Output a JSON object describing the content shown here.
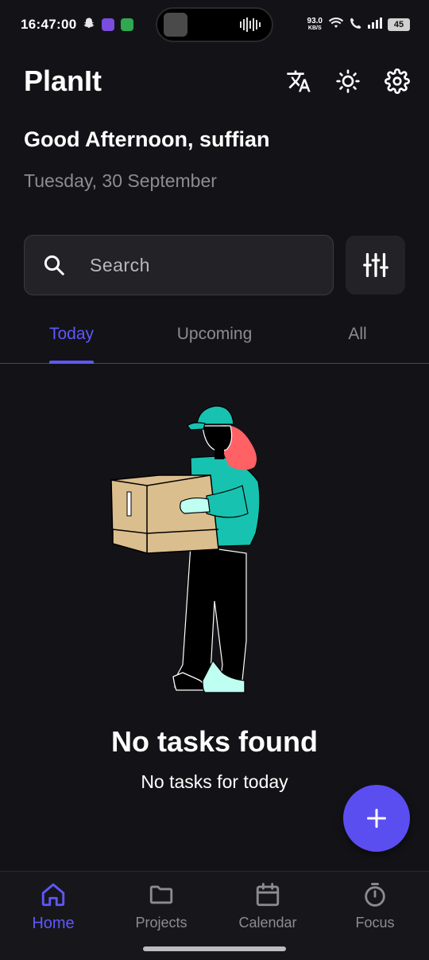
{
  "status_bar": {
    "time": "16:47:00",
    "net_speed_value": "93.0",
    "net_speed_unit": "KB/S",
    "battery": "45"
  },
  "header": {
    "title": "PlanIt",
    "icons": [
      "translate-icon",
      "brightness-icon",
      "settings-icon"
    ]
  },
  "greeting": "Good Afternoon, suffian",
  "date": "Tuesday, 30 September",
  "search": {
    "placeholder": "Search"
  },
  "tabs": [
    {
      "label": "Today",
      "active": true
    },
    {
      "label": "Upcoming",
      "active": false
    },
    {
      "label": "All",
      "active": false
    }
  ],
  "empty_state": {
    "title": "No tasks found",
    "subtitle": "No tasks for today"
  },
  "bottom_nav": [
    {
      "label": "Home",
      "icon": "home-icon",
      "active": true
    },
    {
      "label": "Projects",
      "icon": "folder-icon",
      "active": false
    },
    {
      "label": "Calendar",
      "icon": "calendar-icon",
      "active": false
    },
    {
      "label": "Focus",
      "icon": "timer-icon",
      "active": false
    }
  ],
  "colors": {
    "background": "#131317",
    "accent": "#5f57ff",
    "fab": "#5b4ef0",
    "muted_text": "#8b8b92",
    "surface": "#232327"
  }
}
